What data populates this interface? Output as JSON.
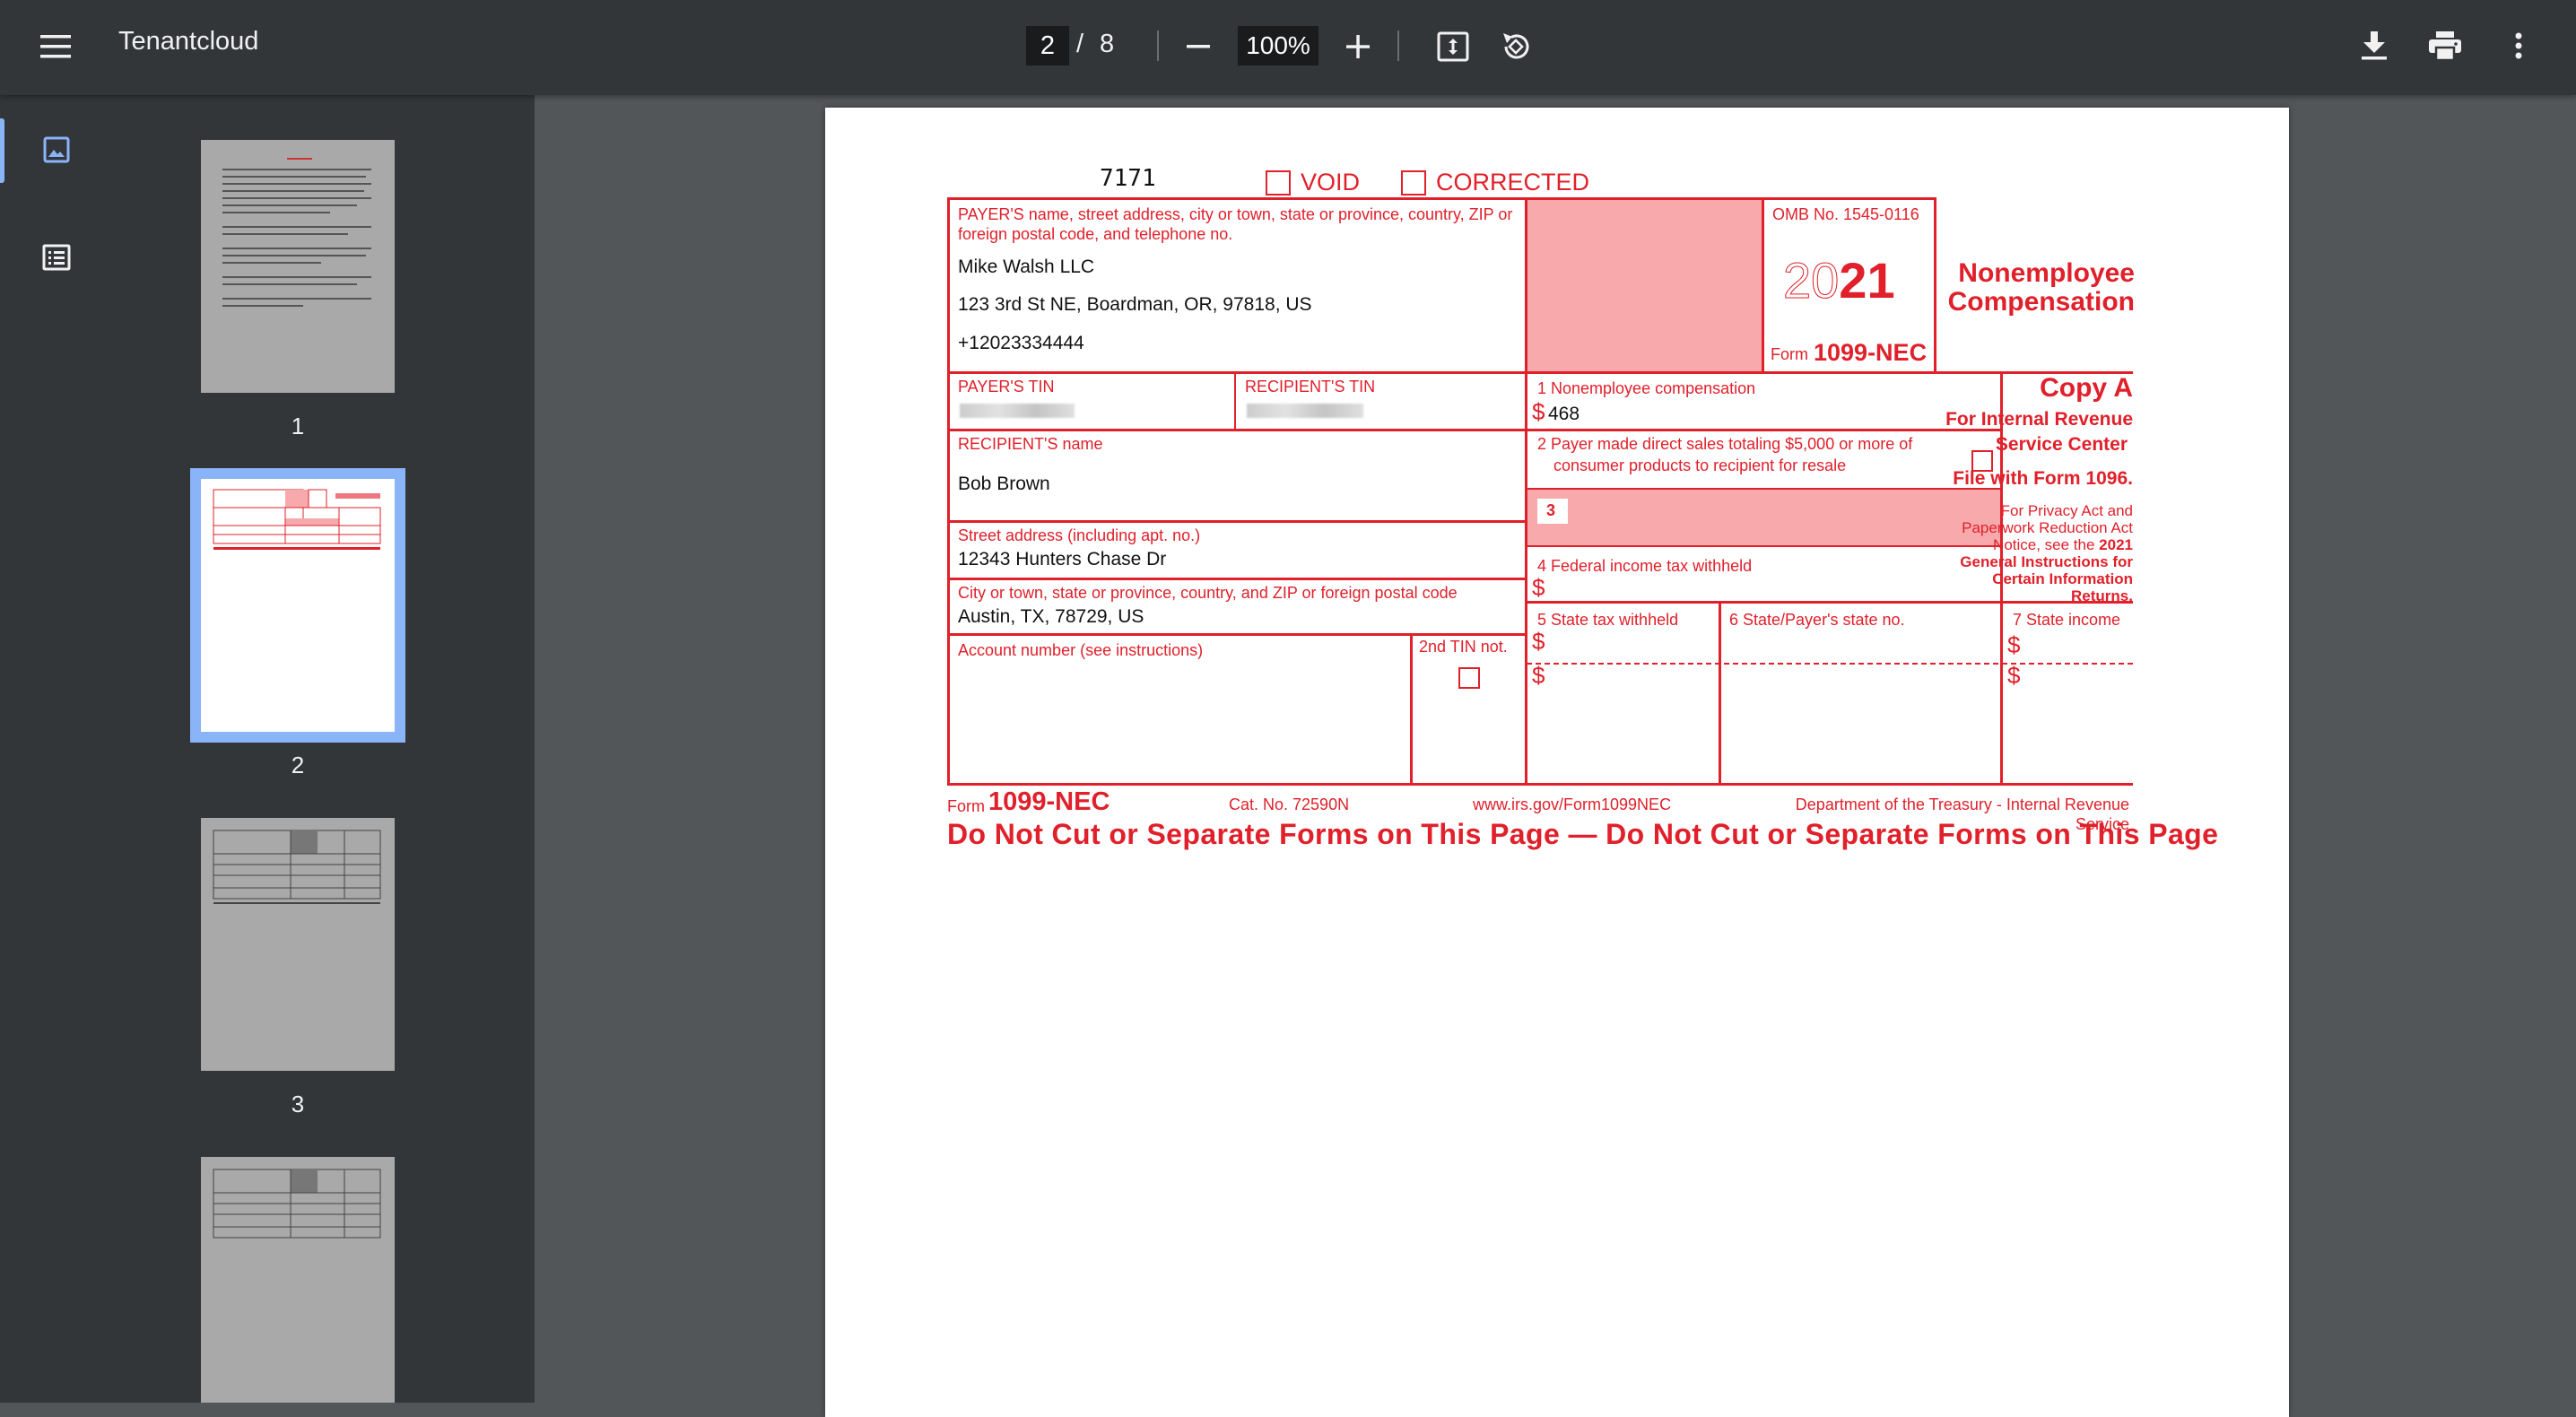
{
  "toolbar": {
    "title": "Tenantcloud",
    "current_page": "2",
    "page_separator": "/",
    "total_pages": "8",
    "zoom": "100%",
    "icons": [
      "menu-icon",
      "zoom-out-icon",
      "zoom-in-icon",
      "fit-page-icon",
      "rotate-icon",
      "download-icon",
      "print-icon",
      "more-vert-icon"
    ]
  },
  "sidebar": {
    "rail_icons": [
      "thumbnails-icon",
      "outline-icon"
    ],
    "thumbnails": [
      {
        "label": "1"
      },
      {
        "label": "2"
      },
      {
        "label": "3"
      }
    ]
  },
  "form": {
    "code": "7171",
    "void_label": "VOID",
    "corrected_label": "CORRECTED",
    "payer_label": "PAYER'S name, street address, city or town, state or province, country, ZIP or foreign postal code, and telephone no.",
    "payer_name": "Mike Walsh LLC",
    "payer_address": "123 3rd St NE, Boardman, OR, 97818, US",
    "payer_phone": "+12023334444",
    "omb": "OMB No. 1545-0116",
    "year_light": "20",
    "year_bold": "21",
    "form_word": "Form",
    "form_name": "1099-NEC",
    "title_line1": "Nonemployee",
    "title_line2": "Compensation",
    "payer_tin_label": "PAYER'S TIN",
    "recipient_tin_label": "RECIPIENT'S TIN",
    "box1_label": "1  Nonemployee compensation",
    "box1_value": "468",
    "dollar": "$",
    "copy_a": "Copy A",
    "copy_irs_1": "For Internal Revenue",
    "copy_irs_2": "Service Center",
    "file_with": "File with Form 1096.",
    "privacy_1": "For Privacy Act and",
    "privacy_2": "Paperwork Reduction Act",
    "privacy_3": "Notice, see the ",
    "privacy_3b": "2021",
    "privacy_4": "General Instructions for",
    "privacy_5": "Certain Information",
    "privacy_6": "Returns.",
    "recipient_name_label": "RECIPIENT'S name",
    "recipient_name": "Bob Brown",
    "box2_label_1": "2  Payer made direct sales totaling $5,000 or more of",
    "box2_label_2": "consumer products to recipient for resale",
    "box3_label": "3",
    "street_label": "Street address (including apt. no.)",
    "street_value": "12343 Hunters Chase Dr",
    "box4_label": "4  Federal income tax withheld",
    "city_label": "City or town, state or province, country, and ZIP or foreign postal code",
    "city_value": "Austin, TX, 78729, US",
    "box5_label": "5  State tax withheld",
    "box6_label": "6  State/Payer's state no.",
    "box7_label": "7  State income",
    "account_label": "Account number (see instructions)",
    "tin_not_label": "2nd TIN not.",
    "footer_form": "Form",
    "footer_form_name": "1099-NEC",
    "footer_cat": "Cat. No. 72590N",
    "footer_url": "www.irs.gov/Form1099NEC",
    "footer_dept": "Department of the Treasury - Internal Revenue Service",
    "do_not_cut": "Do Not Cut or Separate Forms on This Page — Do Not Cut or Separate Forms on This Page"
  }
}
